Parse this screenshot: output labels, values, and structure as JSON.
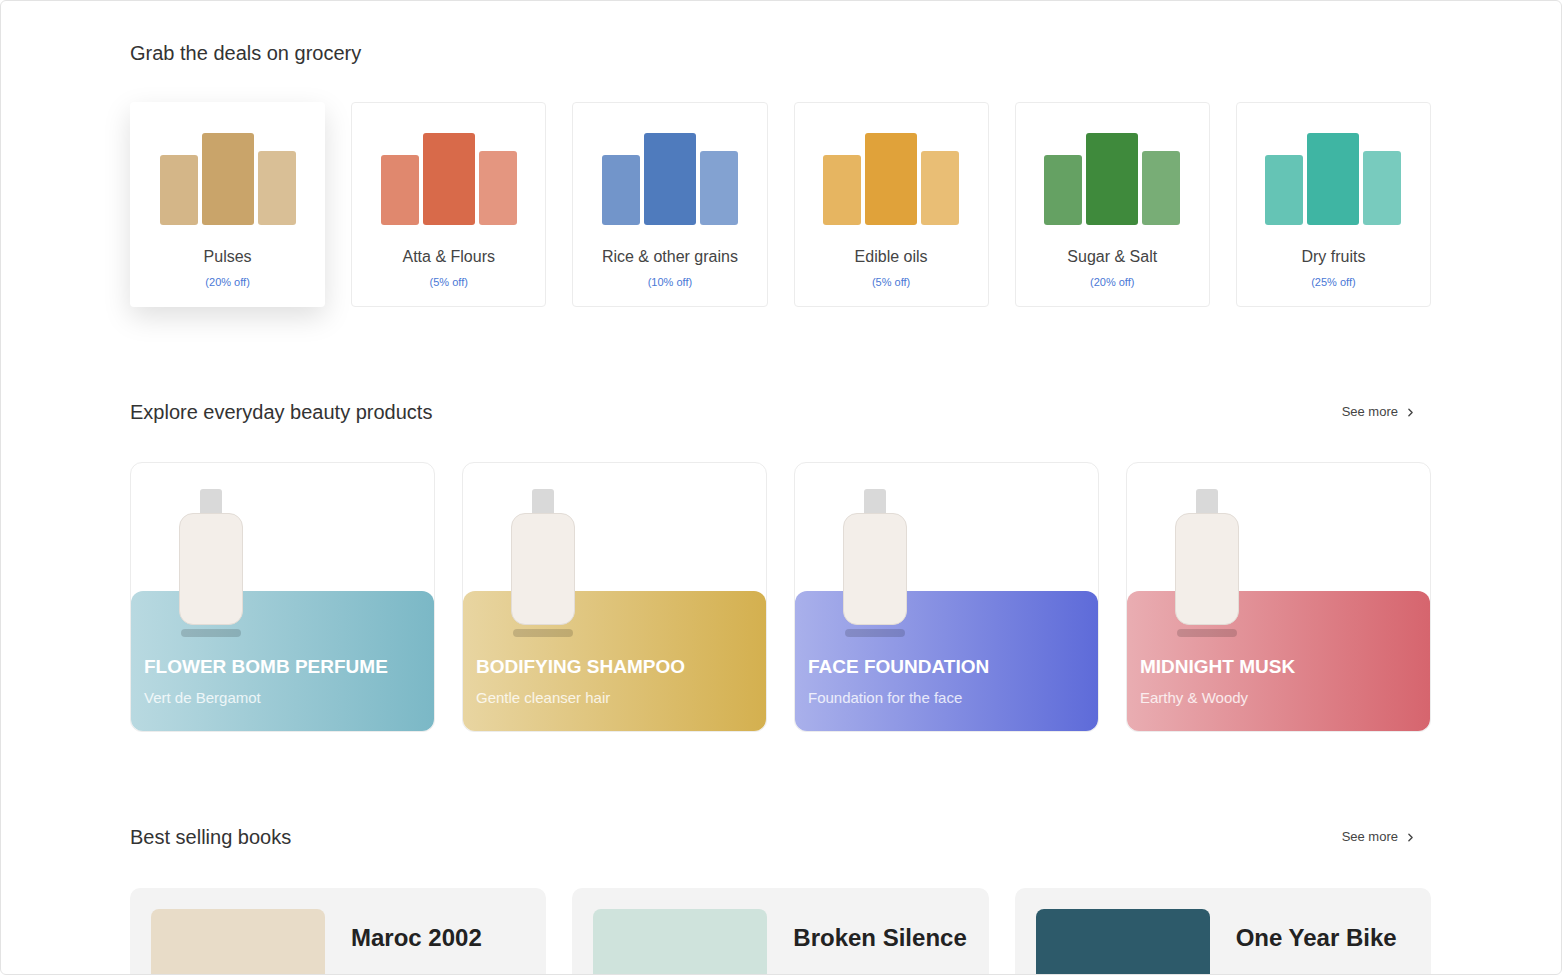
{
  "grocery": {
    "heading": "Grab the deals on grocery",
    "items": [
      {
        "name": "Pulses",
        "discount": "(20% off)",
        "selected": true,
        "color": "#c9a46a"
      },
      {
        "name": "Atta & Flours",
        "discount": "(5% off)",
        "selected": false,
        "color": "#d86a4a"
      },
      {
        "name": "Rice & other grains",
        "discount": "(10% off)",
        "selected": false,
        "color": "#4f7bbd"
      },
      {
        "name": "Edible oils",
        "discount": "(5% off)",
        "selected": false,
        "color": "#e0a23a"
      },
      {
        "name": "Sugar & Salt",
        "discount": "(20% off)",
        "selected": false,
        "color": "#3f8a3c"
      },
      {
        "name": "Dry fruits",
        "discount": "(25% off)",
        "selected": false,
        "color": "#3fb5a3"
      }
    ]
  },
  "beauty": {
    "heading": "Explore everyday beauty products",
    "see_more": "See more",
    "items": [
      {
        "title": "FLOWER BOMB PERFUME",
        "subtitle": "Vert de Bergamot",
        "color": "#7bb8c6"
      },
      {
        "title": "BODIFYING SHAMPOO",
        "subtitle": "Gentle cleanser hair",
        "color": "#d4b04f"
      },
      {
        "title": "FACE FOUNDATION",
        "subtitle": "Foundation for the face",
        "color": "#5e6bd9"
      },
      {
        "title": "MIDNIGHT MUSK",
        "subtitle": "Earthy & Woody",
        "color": "#d6656e"
      }
    ]
  },
  "books": {
    "heading": "Best selling books",
    "see_more": "See more",
    "items": [
      {
        "title": "Maroc 2002",
        "color": "#e8dcc8"
      },
      {
        "title": "Broken Silence",
        "color": "#cfe3dc"
      },
      {
        "title": "One Year Bike",
        "color": "#2d5a6a"
      }
    ]
  }
}
